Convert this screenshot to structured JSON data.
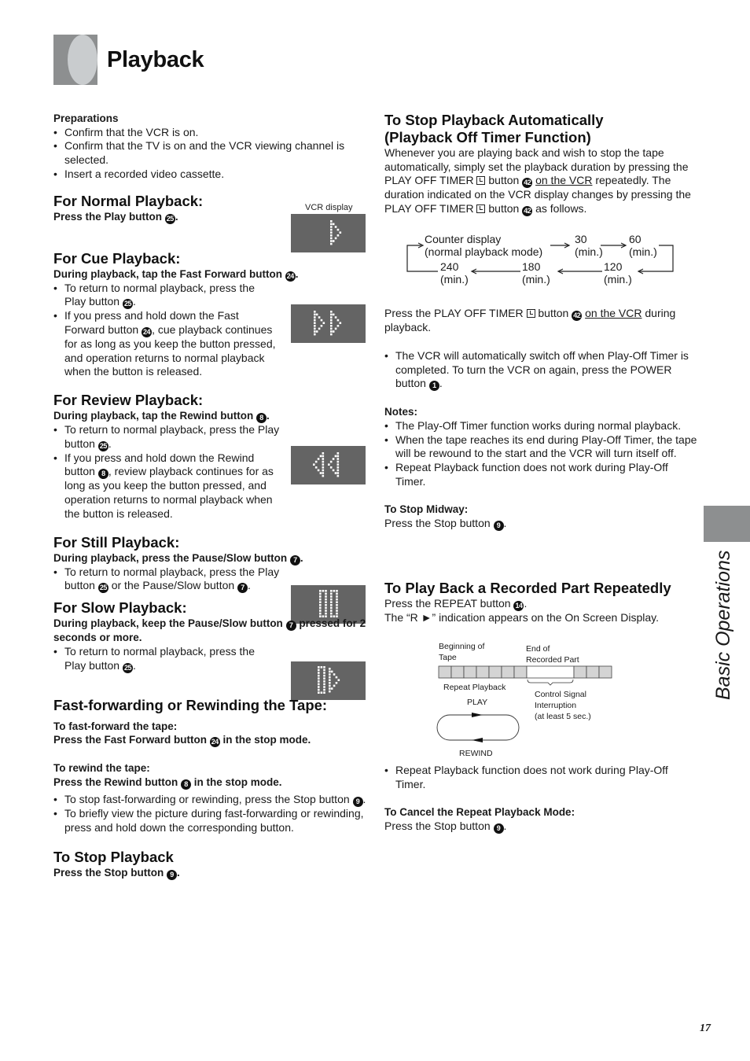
{
  "header": {
    "title": "Playback"
  },
  "side_tab": {
    "label": "Basic Operations"
  },
  "page_number": "17",
  "vcr_display_label": "VCR display",
  "left": {
    "preparations": {
      "title": "Preparations",
      "items": [
        "Confirm that the VCR is on.",
        "Confirm that the TV is on and the VCR viewing channel is selected.",
        "Insert a recorded video cassette."
      ]
    },
    "normal": {
      "title": "For Normal Playback:",
      "instruction": "Press the Play button",
      "button_num": "25",
      "display": "play"
    },
    "cue": {
      "title": "For Cue Playback:",
      "instruction": "During playback, tap the Fast Forward button",
      "button_num": "24",
      "b1a": "To return to normal playback, press the Play button",
      "b1num": "25",
      "b2a": "If you press and hold down the Fast Forward button",
      "b2num": "24",
      "b2b": ", cue playback continues for as long as you keep the button pressed, and operation returns to normal playback when the button is released.",
      "display": "cue"
    },
    "review": {
      "title": "For Review Playback:",
      "instruction": "During playback, tap the Rewind button",
      "button_num": "8",
      "b1a": "To return to normal playback, press the Play button",
      "b1num": "25",
      "b2a": "If you press and hold down the Rewind button",
      "b2num": "8",
      "b2b": ", review playback continues for as long as you keep the button pressed, and operation returns to normal playback when the button is released.",
      "display": "review"
    },
    "still": {
      "title": "For Still Playback:",
      "instruction": "During playback, press the Pause/Slow button",
      "button_num": "7",
      "b1a": "To return to normal playback, press the Play button",
      "b1num": "25",
      "b1b": " or the Pause/Slow button",
      "b1num2": "7",
      "display": "still"
    },
    "slow": {
      "title": "For Slow Playback:",
      "instruction_a": "During playback, keep the Pause/Slow button",
      "button_num": "7",
      "instruction_b": " pressed for 2 seconds or more.",
      "b1a": "To return to normal playback, press the Play button",
      "b1num": "25",
      "display": "slow"
    },
    "ffrew": {
      "title": "Fast-forwarding or Rewinding the Tape:",
      "ff_label": "To fast-forward the tape:",
      "ff_instr_a": "Press the Fast Forward button",
      "ff_num": "24",
      "ff_instr_b": " in the stop mode.",
      "rew_label": "To rewind the tape:",
      "rew_instr_a": "Press the Rewind button",
      "rew_num": "8",
      "rew_instr_b": " in the stop mode.",
      "b1a": "To stop fast-forwarding or rewinding, press the Stop button",
      "b1num": "9",
      "b2": "To briefly view the picture during fast-forwarding or rewinding, press and hold down the corresponding button."
    },
    "stop": {
      "title": "To Stop Playback",
      "instruction": "Press the Stop button",
      "button_num": "9"
    }
  },
  "right": {
    "auto_stop": {
      "title_line1": "To Stop Playback Automatically",
      "title_line2": "(Playback Off Timer Function)",
      "p1a": "Whenever you are playing back and wish to stop the tape automatically, simply set the playback duration by pressing the PLAY OFF TIMER",
      "p1b": " button",
      "p1num": "42",
      "p1link": "on the VCR",
      "p1c": " repeatedly. The duration indicated on the VCR display changes by pressing the PLAY OFF TIMER",
      "p1d": " button",
      "p1num2": "42",
      "p1e": " as follows.",
      "cycle": {
        "start_line1": "Counter display",
        "start_line2": "(normal playback mode)",
        "steps": [
          {
            "value": "30",
            "unit": "(min.)"
          },
          {
            "value": "60",
            "unit": "(min.)"
          },
          {
            "value": "120",
            "unit": "(min.)"
          },
          {
            "value": "180",
            "unit": "(min.)"
          },
          {
            "value": "240",
            "unit": "(min.)"
          }
        ]
      },
      "p2a": "Press the PLAY OFF TIMER",
      "p2b": " button",
      "p2num": "42",
      "p2link": "on the VCR",
      "p2c": " during playback.",
      "bullet_a": "The VCR will automatically switch off when Play-Off Timer is completed. To turn the VCR on again, press the POWER button",
      "bullet_num": "1",
      "notes_title": "Notes:",
      "notes": [
        "The Play-Off Timer function works during normal playback.",
        "When the tape reaches its end during Play-Off Timer, the tape will be rewound to the start and the VCR will turn itself off.",
        "Repeat Playback function does not work during Play-Off Timer."
      ],
      "midway_title": "To Stop Midway:",
      "midway_instr": "Press the Stop button",
      "midway_num": "9"
    },
    "repeat": {
      "title": "To Play Back a Recorded Part Repeatedly",
      "p1": "Press the REPEAT button",
      "p1num": "14",
      "p2": "The “R ►” indication appears on the On Screen Display.",
      "diagram": {
        "beginning_label": "Beginning of\nTape",
        "end_label": "End of\nRecorded Part",
        "repeat_label": "Repeat Playback",
        "play_label": "PLAY",
        "rewind_label": "REWIND",
        "interrupt_label_1": "Control Signal",
        "interrupt_label_2": "Interruption",
        "interrupt_label_3": "(at least 5 sec.)",
        "cells_before": 7,
        "cells_after": 3
      },
      "bullet": "Repeat Playback function does not work during Play-Off Timer.",
      "cancel_title": "To Cancel the Repeat Playback Mode:",
      "cancel_instr": "Press the Stop button",
      "cancel_num": "9"
    }
  },
  "colors": {
    "tab_dark": "#8d8f90",
    "tab_light": "#c9ccce",
    "display_bg": "#646464",
    "tape_cell": "#d4d4d4"
  }
}
